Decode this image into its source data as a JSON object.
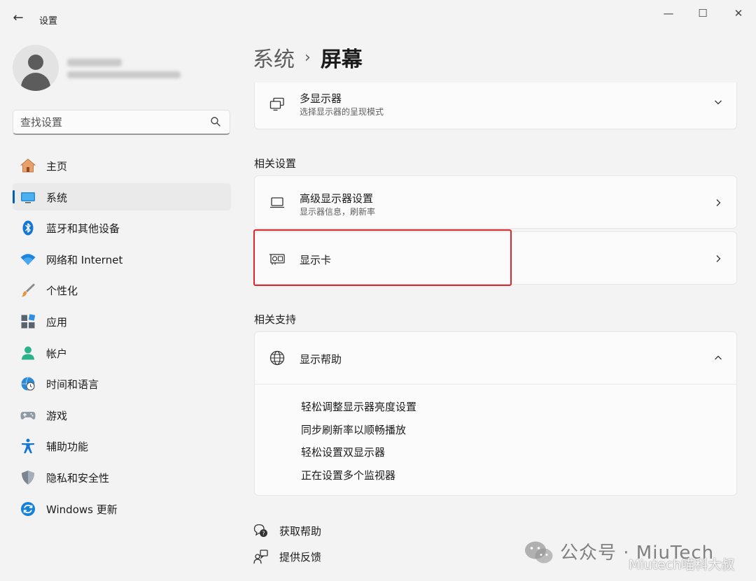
{
  "window": {
    "title": "设置",
    "back_glyph": "←",
    "minimize_glyph": "—",
    "maximize_glyph": "☐",
    "close_glyph": "✕"
  },
  "search": {
    "placeholder": "查找设置"
  },
  "sidebar": {
    "items": [
      {
        "label": "主页",
        "icon": "home-icon",
        "active": false
      },
      {
        "label": "系统",
        "icon": "system-display-icon",
        "active": true
      },
      {
        "label": "蓝牙和其他设备",
        "icon": "bluetooth-icon",
        "active": false
      },
      {
        "label": "网络和 Internet",
        "icon": "wifi-icon",
        "active": false
      },
      {
        "label": "个性化",
        "icon": "brush-icon",
        "active": false
      },
      {
        "label": "应用",
        "icon": "apps-icon",
        "active": false
      },
      {
        "label": "帐户",
        "icon": "account-icon",
        "active": false
      },
      {
        "label": "时间和语言",
        "icon": "time-language-icon",
        "active": false
      },
      {
        "label": "游戏",
        "icon": "gamepad-icon",
        "active": false
      },
      {
        "label": "辅助功能",
        "icon": "accessibility-icon",
        "active": false
      },
      {
        "label": "隐私和安全性",
        "icon": "shield-icon",
        "active": false
      },
      {
        "label": "Windows 更新",
        "icon": "windows-update-icon",
        "active": false
      }
    ]
  },
  "breadcrumb": {
    "parent": "系统",
    "separator": "›",
    "current": "屏幕"
  },
  "cards": {
    "multi_display": {
      "title": "多显示器",
      "subtitle": "选择显示器的呈现模式",
      "icon": "multi-monitor-icon"
    },
    "advanced_display": {
      "title": "高级显示器设置",
      "subtitle": "显示器信息，刷新率",
      "icon": "laptop-icon"
    },
    "graphics": {
      "title": "显示卡",
      "icon": "graphics-card-icon"
    },
    "display_help": {
      "title": "显示帮助",
      "icon": "globe-icon"
    }
  },
  "sections": {
    "related_settings": "相关设置",
    "related_support": "相关支持"
  },
  "help_links": [
    "轻松调整显示器亮度设置",
    "同步刷新率以顺畅播放",
    "轻松设置双显示器",
    "正在设置多个监视器"
  ],
  "footer": {
    "get_help": "获取帮助",
    "feedback": "提供反馈"
  },
  "watermark": {
    "line1": "公众号 · MiuTech",
    "line2": "Miutech喵科大叔"
  },
  "colors": {
    "accent": "#005fb8",
    "highlight_border": "#e0252b",
    "background": "#f3f3f3",
    "card": "#fbfbfb"
  }
}
